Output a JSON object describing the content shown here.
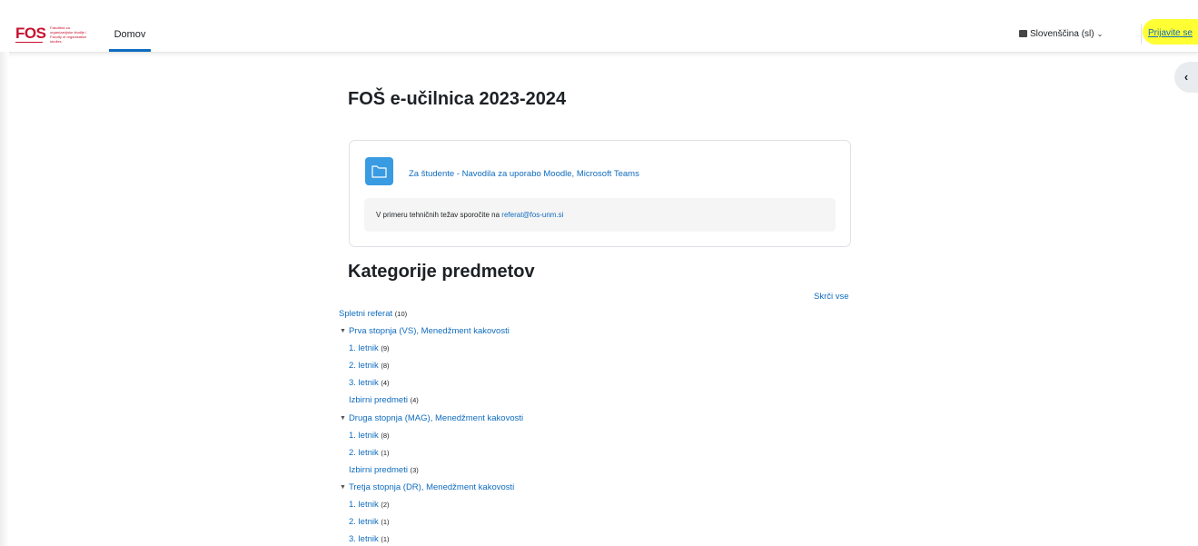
{
  "header": {
    "logo_text": "FOS",
    "logo_tagline": "Fakulteta za organizacijske študije / Faculty of organisation studies",
    "nav_home": "Domov",
    "language": "Slovenščina (sl)",
    "login": "Prijavite se"
  },
  "main": {
    "title": "FOŠ e-učilnica 2023-2024",
    "card": {
      "link": "Za študente - Navodila za uporabo Moodle, Microsoft Teams",
      "info_text": "V primeru tehničnih težav sporočite na ",
      "info_email": "referat@fos-unm.si"
    },
    "categories_title": "Kategorije predmetov",
    "collapse_all": "Skrči vse",
    "categories": [
      {
        "label": "Spletni referat",
        "count": "(10)"
      },
      {
        "label": "Prva stopnja (VS), Menedžment kakovosti",
        "expanded": true
      },
      {
        "label": "1. letnik",
        "count": "(9)"
      },
      {
        "label": "2. letnik",
        "count": "(8)"
      },
      {
        "label": "3. letnik",
        "count": "(4)"
      },
      {
        "label": "Izbirni predmeti",
        "count": "(4)"
      },
      {
        "label": "Druga stopnja (MAG), Menedžment kakovosti",
        "expanded": true
      },
      {
        "label": "1. letnik",
        "count": "(8)"
      },
      {
        "label": "2. letnik",
        "count": "(1)"
      },
      {
        "label": "Izbirni predmeti",
        "count": "(3)"
      },
      {
        "label": "Tretja stopnja (DR), Menedžment kakovosti",
        "expanded": true
      },
      {
        "label": "1. letnik",
        "count": "(2)"
      },
      {
        "label": "2. letnik",
        "count": "(1)"
      },
      {
        "label": "3. letnik",
        "count": "(1)"
      }
    ]
  },
  "colors": {
    "accent": "#0f6cbf",
    "brand": "#c8102e",
    "highlight": "#ffff33",
    "folder": "#399be2"
  },
  "icons": {
    "folder": "folder-icon",
    "expanded": "caret-down-icon",
    "drawer": "chevron-left-icon",
    "language": "language-icon"
  }
}
